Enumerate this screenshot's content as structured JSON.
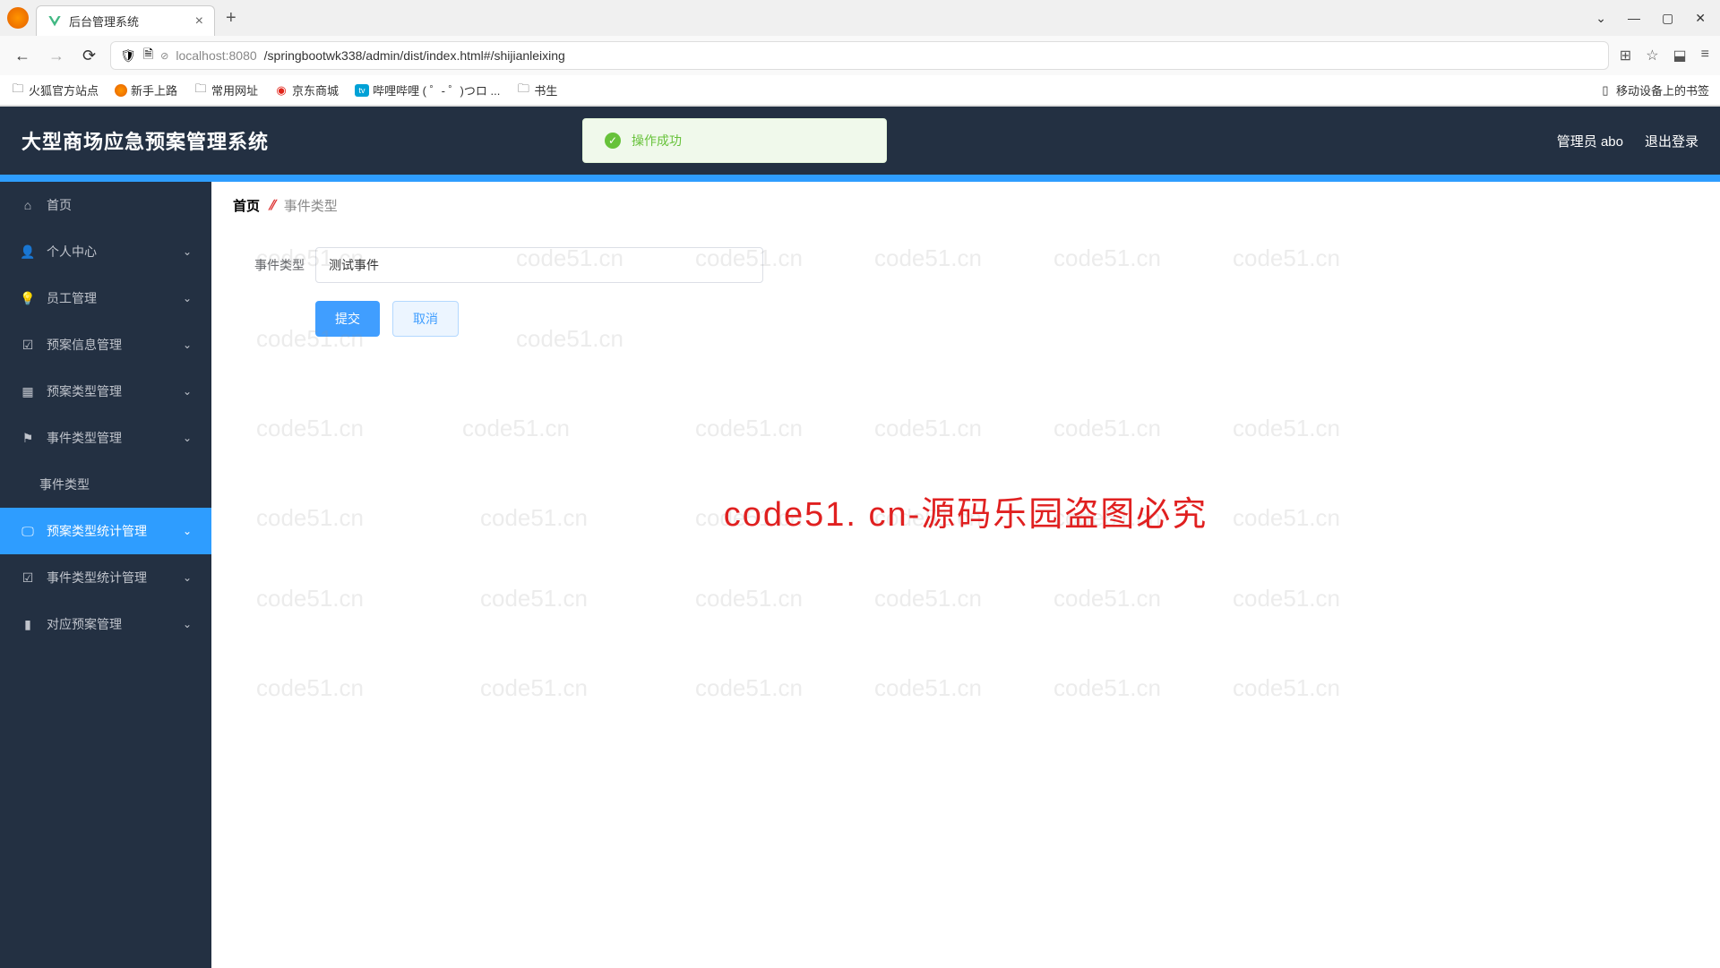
{
  "browser": {
    "tab_title": "后台管理系统",
    "url_host": "localhost:8080",
    "url_path": "/springbootwk338/admin/dist/index.html#/shijianleixing",
    "bookmarks": [
      "火狐官方站点",
      "新手上路",
      "常用网址",
      "京东商城",
      "哔哩哔哩 (  ゜- ゜)つロ ...",
      "书生"
    ],
    "mobile_bookmarks": "移动设备上的书签"
  },
  "header": {
    "title": "大型商场应急预案管理系统",
    "toast": "操作成功",
    "user": "管理员 abo",
    "logout": "退出登录"
  },
  "sidebar": {
    "items": [
      {
        "label": "首页",
        "icon": "home"
      },
      {
        "label": "个人中心",
        "icon": "user",
        "expandable": true
      },
      {
        "label": "员工管理",
        "icon": "bulb",
        "expandable": true
      },
      {
        "label": "预案信息管理",
        "icon": "check",
        "expandable": true
      },
      {
        "label": "预案类型管理",
        "icon": "grid",
        "expandable": true
      },
      {
        "label": "事件类型管理",
        "icon": "flag",
        "expandable": true
      },
      {
        "label": "事件类型",
        "sub": true
      },
      {
        "label": "预案类型统计管理",
        "icon": "monitor",
        "expandable": true,
        "active": true
      },
      {
        "label": "事件类型统计管理",
        "icon": "check",
        "expandable": true
      },
      {
        "label": "对应预案管理",
        "icon": "bars",
        "expandable": true
      }
    ]
  },
  "breadcrumb": {
    "home": "首页",
    "current": "事件类型"
  },
  "form": {
    "label": "事件类型",
    "value": "测试事件",
    "submit": "提交",
    "cancel": "取消"
  },
  "watermark": {
    "big": "code51. cn-源码乐园盗图必究",
    "small": "code51.cn"
  }
}
